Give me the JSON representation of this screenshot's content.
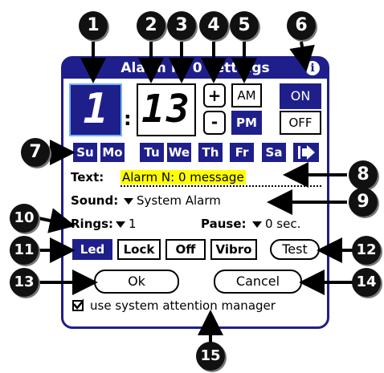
{
  "dialog": {
    "title": "Alarm N: 0 settings",
    "info_icon": "i",
    "hour": "1",
    "separator": ":",
    "minute": "13",
    "plus_label": "+",
    "minus_label": "-",
    "am_label": "AM",
    "pm_label": "PM",
    "on_label": "ON",
    "off_label": "OFF",
    "days": [
      "Su",
      "Mo",
      "Tu",
      "We",
      "Th",
      "Fr",
      "Sa"
    ],
    "text_label": "Text:",
    "text_value": "Alarm N: 0 message",
    "sound_label": "Sound:",
    "sound_value": "System Alarm",
    "rings_label": "Rings:",
    "rings_value": "1",
    "pause_label": "Pause:",
    "pause_value": "0 sec.",
    "modes": [
      "Led",
      "Lock",
      "Off",
      "Vibro"
    ],
    "test_label": "Test",
    "ok_label": "Ok",
    "cancel_label": "Cancel",
    "checkbox_checked": true,
    "checkbox_label": "use system attention manager"
  },
  "callouts": [
    "1",
    "2",
    "3",
    "4",
    "5",
    "6",
    "7",
    "8",
    "9",
    "10",
    "11",
    "12",
    "13",
    "14",
    "15"
  ],
  "colors": {
    "accent": "#1f1f8c",
    "highlight": "#ffff00"
  }
}
